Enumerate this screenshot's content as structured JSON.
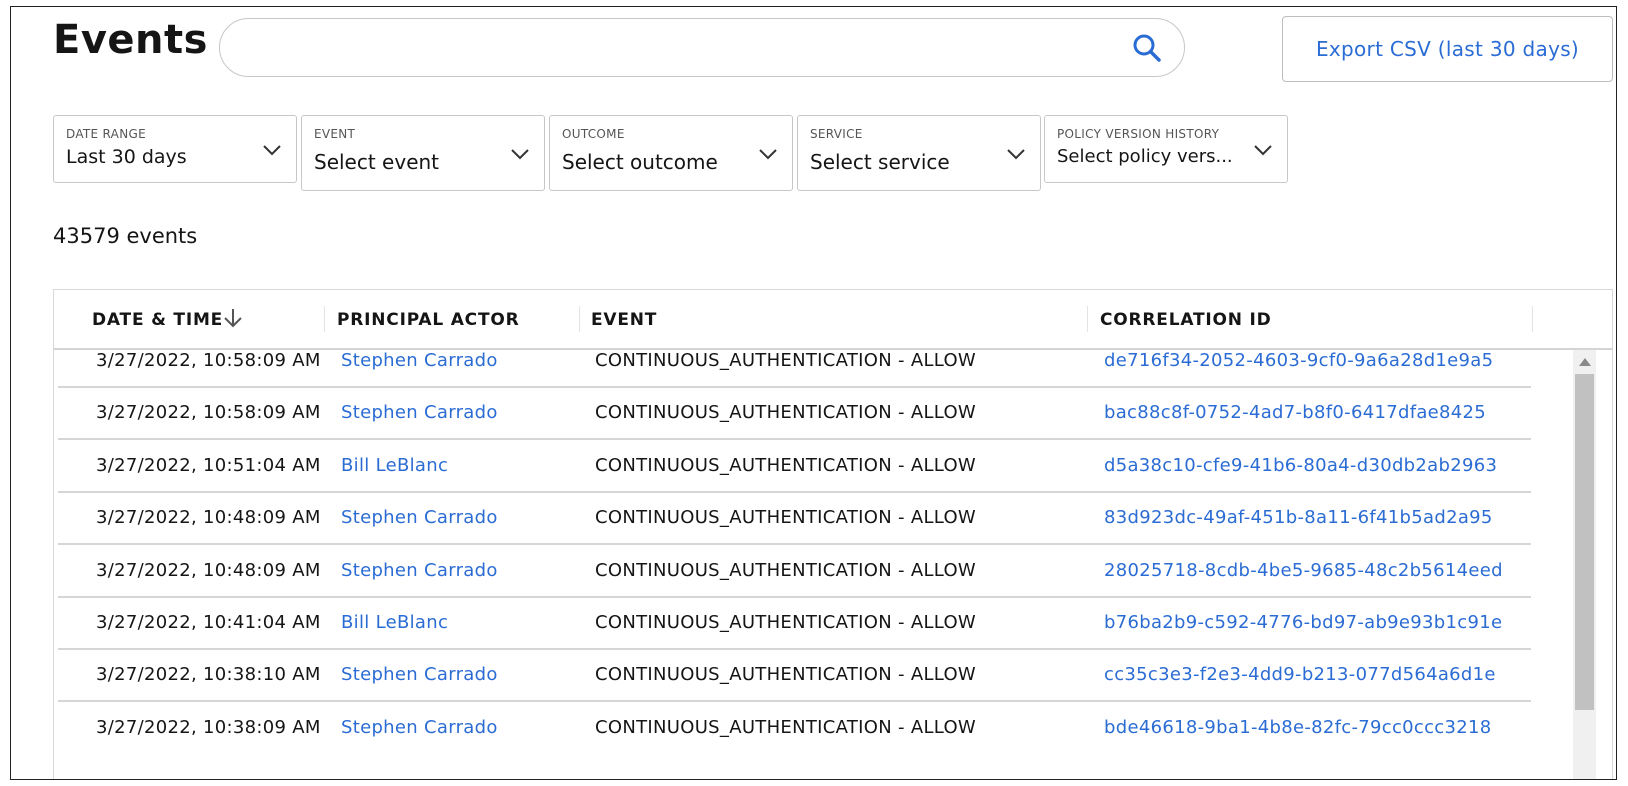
{
  "header": {
    "title": "Events",
    "search_placeholder": "",
    "export_label": "Export CSV (last 30 days)"
  },
  "filters": [
    {
      "label": "DATE RANGE",
      "value": "Last 30 days"
    },
    {
      "label": "EVENT",
      "value": "Select event"
    },
    {
      "label": "OUTCOME",
      "value": "Select outcome"
    },
    {
      "label": "SERVICE",
      "value": "Select service"
    },
    {
      "label": "POLICY VERSION HISTORY",
      "value": "Select policy vers..."
    }
  ],
  "event_count": "43579 events",
  "table": {
    "columns": [
      "DATE & TIME",
      "PRINCIPAL ACTOR",
      "EVENT",
      "CORRELATION ID"
    ],
    "sort_icon": "arrow-down-icon",
    "rows": [
      {
        "date": "3/27/2022, 10:58:09 AM",
        "actor": "Stephen Carrado",
        "event": "CONTINUOUS_AUTHENTICATION - ALLOW",
        "correlation_id": "de716f34-2052-4603-9cf0-9a6a28d1e9a5"
      },
      {
        "date": "3/27/2022, 10:58:09 AM",
        "actor": "Stephen Carrado",
        "event": "CONTINUOUS_AUTHENTICATION - ALLOW",
        "correlation_id": "bac88c8f-0752-4ad7-b8f0-6417dfae8425"
      },
      {
        "date": "3/27/2022, 10:51:04 AM",
        "actor": "Bill LeBlanc",
        "event": "CONTINUOUS_AUTHENTICATION - ALLOW",
        "correlation_id": "d5a38c10-cfe9-41b6-80a4-d30db2ab2963"
      },
      {
        "date": "3/27/2022, 10:48:09 AM",
        "actor": "Stephen Carrado",
        "event": "CONTINUOUS_AUTHENTICATION - ALLOW",
        "correlation_id": "83d923dc-49af-451b-8a11-6f41b5ad2a95"
      },
      {
        "date": "3/27/2022, 10:48:09 AM",
        "actor": "Stephen Carrado",
        "event": "CONTINUOUS_AUTHENTICATION - ALLOW",
        "correlation_id": "28025718-8cdb-4be5-9685-48c2b5614eed"
      },
      {
        "date": "3/27/2022, 10:41:04 AM",
        "actor": "Bill LeBlanc",
        "event": "CONTINUOUS_AUTHENTICATION - ALLOW",
        "correlation_id": "b76ba2b9-c592-4776-bd97-ab9e93b1c91e"
      },
      {
        "date": "3/27/2022, 10:38:10 AM",
        "actor": "Stephen Carrado",
        "event": "CONTINUOUS_AUTHENTICATION - ALLOW",
        "correlation_id": "cc35c3e3-f2e3-4dd9-b213-077d564a6d1e"
      },
      {
        "date": "3/27/2022, 10:38:09 AM",
        "actor": "Stephen Carrado",
        "event": "CONTINUOUS_AUTHENTICATION - ALLOW",
        "correlation_id": "bde46618-9ba1-4b8e-82fc-79cc0ccc3218"
      }
    ]
  },
  "colors": {
    "link": "#2b6cd4",
    "text": "#151515",
    "border": "#c7c7c7"
  }
}
